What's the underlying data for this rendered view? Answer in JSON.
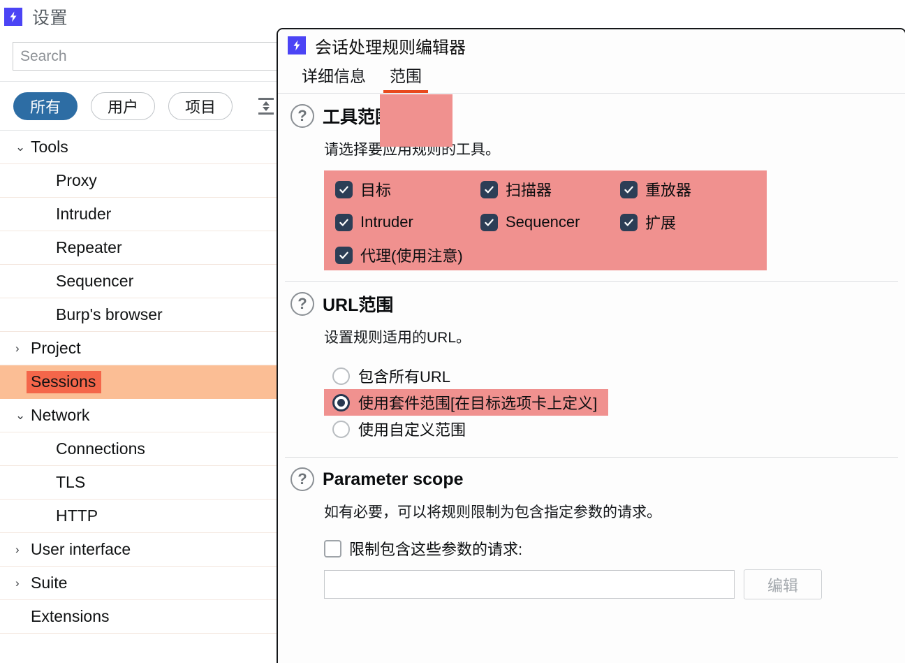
{
  "settings_window": {
    "app_icon": "burp-lightning-icon",
    "title": "设置",
    "search": {
      "placeholder": "Search",
      "value": ""
    },
    "filters": [
      {
        "label": "所有",
        "active": true
      },
      {
        "label": "用户",
        "active": false
      },
      {
        "label": "项目",
        "active": false
      }
    ],
    "sort_icon": "collapse-expand-icon",
    "tree": [
      {
        "label": "Tools",
        "level": 0,
        "chevron": "⌄",
        "selected": false
      },
      {
        "label": "Proxy",
        "level": 1,
        "chevron": "",
        "selected": false
      },
      {
        "label": "Intruder",
        "level": 1,
        "chevron": "",
        "selected": false
      },
      {
        "label": "Repeater",
        "level": 1,
        "chevron": "",
        "selected": false
      },
      {
        "label": "Sequencer",
        "level": 1,
        "chevron": "",
        "selected": false
      },
      {
        "label": "Burp's browser",
        "level": 1,
        "chevron": "",
        "selected": false
      },
      {
        "label": "Project",
        "level": 0,
        "chevron": "›",
        "selected": false
      },
      {
        "label": "Sessions",
        "level": 0,
        "chevron": "",
        "selected": true
      },
      {
        "label": "Network",
        "level": 0,
        "chevron": "⌄",
        "selected": false
      },
      {
        "label": "Connections",
        "level": 1,
        "chevron": "",
        "selected": false
      },
      {
        "label": "TLS",
        "level": 1,
        "chevron": "",
        "selected": false
      },
      {
        "label": "HTTP",
        "level": 1,
        "chevron": "",
        "selected": false
      },
      {
        "label": "User interface",
        "level": 0,
        "chevron": "›",
        "selected": false
      },
      {
        "label": "Suite",
        "level": 0,
        "chevron": "›",
        "selected": false
      },
      {
        "label": "Extensions",
        "level": 0,
        "chevron": "",
        "selected": false
      }
    ]
  },
  "dialog": {
    "icon": "burp-lightning-icon",
    "title": "会话处理规则编辑器",
    "tabs": [
      {
        "label": "详细信息",
        "active": false
      },
      {
        "label": "范围",
        "active": true
      }
    ],
    "tool_scope": {
      "help_icon": "question-mark-icon",
      "title": "工具范围",
      "description": "请选择要应用规则的工具。",
      "checkboxes": [
        {
          "label": "目标",
          "checked": true
        },
        {
          "label": "扫描器",
          "checked": true
        },
        {
          "label": "重放器",
          "checked": true
        },
        {
          "label": "Intruder",
          "checked": true
        },
        {
          "label": "Sequencer",
          "checked": true
        },
        {
          "label": "扩展",
          "checked": true
        },
        {
          "label": "代理(使用注意)",
          "checked": true
        }
      ]
    },
    "url_scope": {
      "help_icon": "question-mark-icon",
      "title": "URL范围",
      "description": "设置规则适用的URL。",
      "options": [
        {
          "label": "包含所有URL",
          "selected": false,
          "highlighted": false
        },
        {
          "label": "使用套件范围[在目标选项卡上定义]",
          "selected": true,
          "highlighted": true
        },
        {
          "label": "使用自定义范围",
          "selected": false,
          "highlighted": false
        }
      ]
    },
    "parameter_scope": {
      "help_icon": "question-mark-icon",
      "title": "Parameter scope",
      "description": "如有必要，可以将规则限制为包含指定参数的请求。",
      "restrict_checkbox": {
        "label": "限制包含这些参数的请求:",
        "checked": false
      },
      "param_input": {
        "value": "",
        "placeholder": ""
      },
      "edit_button": {
        "label": "编辑",
        "disabled": true
      }
    }
  },
  "colors": {
    "annotation_pink": "#f0918f",
    "tab_underline_orange": "#e8491d",
    "sidebar_selected_row": "#fbbe95",
    "sidebar_selected_label": "#f4664a",
    "checkbox_navy": "#2c3e56",
    "pill_active_blue": "#2d6da4",
    "burp_logo_blue": "#4b44f5"
  }
}
